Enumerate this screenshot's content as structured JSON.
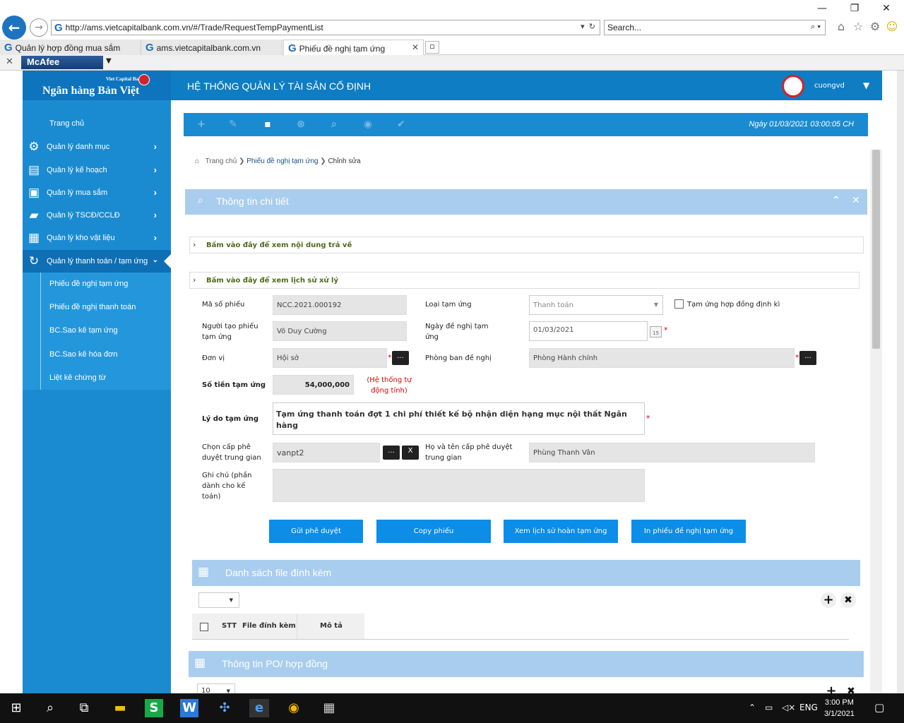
{
  "browser": {
    "address_url": "http://ams.vietcapitalbank.com.vn/#/Trade/RequestTempPaymentList",
    "search_placeholder": "Search...",
    "tabs": [
      {
        "label": "Quản lý hợp đồng mua sắm"
      },
      {
        "label": "ams.vietcapitalbank.com.vn"
      },
      {
        "label": "Phiếu đề nghị tạm ứng"
      }
    ],
    "addon_label": "McAfee"
  },
  "brand": {
    "small": "Viet Capital Bank",
    "name": "Ngân hàng Bản Việt"
  },
  "header": {
    "title": "HỆ THỐNG QUẢN LÝ TÀI SẢN CỐ ĐỊNH",
    "username": "cuongvd"
  },
  "sidebar": {
    "home": "Trang chủ",
    "items": [
      {
        "label": "Quản lý danh mục",
        "icon": "gear-icon"
      },
      {
        "label": "Quản lý kế hoạch",
        "icon": "presentation-icon"
      },
      {
        "label": "Quản lý mua sắm",
        "icon": "cart-document-icon"
      },
      {
        "label": "Quản lý TSCĐ/CCLĐ",
        "icon": "shopping-bag-icon"
      },
      {
        "label": "Quản lý kho vật liệu",
        "icon": "toolbox-icon"
      },
      {
        "label": "Quản lý thanh toán / tạm ứng",
        "icon": "refresh-cycle-icon"
      }
    ],
    "subitems": [
      "Phiếu đề nghị tạm ứng",
      "Phiếu đề nghị thanh toán",
      "BC.Sao kê tạm ứng",
      "BC.Sao kê hóa đơn",
      "Liệt kê chứng từ"
    ]
  },
  "toolbar": {
    "date_text": "Ngày 01/03/2021   03:00:05 CH"
  },
  "breadcrumb": {
    "home": "Trang chủ",
    "parent": "Phiếu đề nghị tạm ứng",
    "current": "Chỉnh sửa"
  },
  "detail": {
    "title": "Thông tin chi tiết",
    "collapse_return": "Bấm vào đây để xem nội dung trả về",
    "collapse_history": "Bấm vào đây để xem lịch sử xử lý"
  },
  "form": {
    "ma_so_phieu_label": "Mã số phiếu",
    "ma_so_phieu": "NCC.2021.000192",
    "loai_tam_ung_label": "Loại tạm ứng",
    "loai_tam_ung": "Thanh toán",
    "hop_dong_dinh_ki_label": "Tạm ứng hợp đồng định kì",
    "nguoi_tao_label": "Người tạo phiếu tạm ứng",
    "nguoi_tao": "Võ Duy Cường",
    "ngay_de_nghi_label": "Ngày đề nghị tạm ứng",
    "ngay_de_nghi": "01/03/2021",
    "don_vi_label": "Đơn vị",
    "don_vi": "Hội sở",
    "phong_ban_label": "Phòng ban đề nghị",
    "phong_ban": "Phòng Hành chính",
    "so_tien_label": "Số tiền tạm ứng",
    "so_tien": "54,000,000",
    "so_tien_note": "(Hệ thống tự động tính)",
    "ly_do_label": "Lý do tạm ứng",
    "ly_do": "Tạm ứng thanh toán đợt 1 chi phí thiết kế bộ nhận diện hạng mục nội thất Ngân hàng",
    "cap_trung_gian_label": "Chọn cấp phê duyệt trung gian",
    "cap_trung_gian": "vanpt2",
    "ho_ten_cap_label": "Họ và tên cấp phê duyệt trung gian",
    "ho_ten_cap": "Phùng Thanh Vân",
    "ghi_chu_label": "Ghi chú (phần dành cho kế toán)",
    "ghi_chu": "",
    "dots_label": "...",
    "clear_label": "X",
    "calendar_day": "15"
  },
  "actions": {
    "send": "Gửi phê duyệt",
    "copy": "Copy phiếu",
    "history": "Xem lịch sử hoàn tạm ứng",
    "print": "In phiếu đề nghị tạm ứng"
  },
  "files": {
    "title": "Danh sách file đính kèm",
    "columns": [
      "STT",
      "File đính kèm",
      "Mô tả"
    ]
  },
  "po": {
    "title": "Thông tin PO/ hợp đồng",
    "page_size": "10"
  },
  "taskbar": {
    "lang": "ENG",
    "time": "3:00 PM",
    "date": "3/1/2021"
  }
}
